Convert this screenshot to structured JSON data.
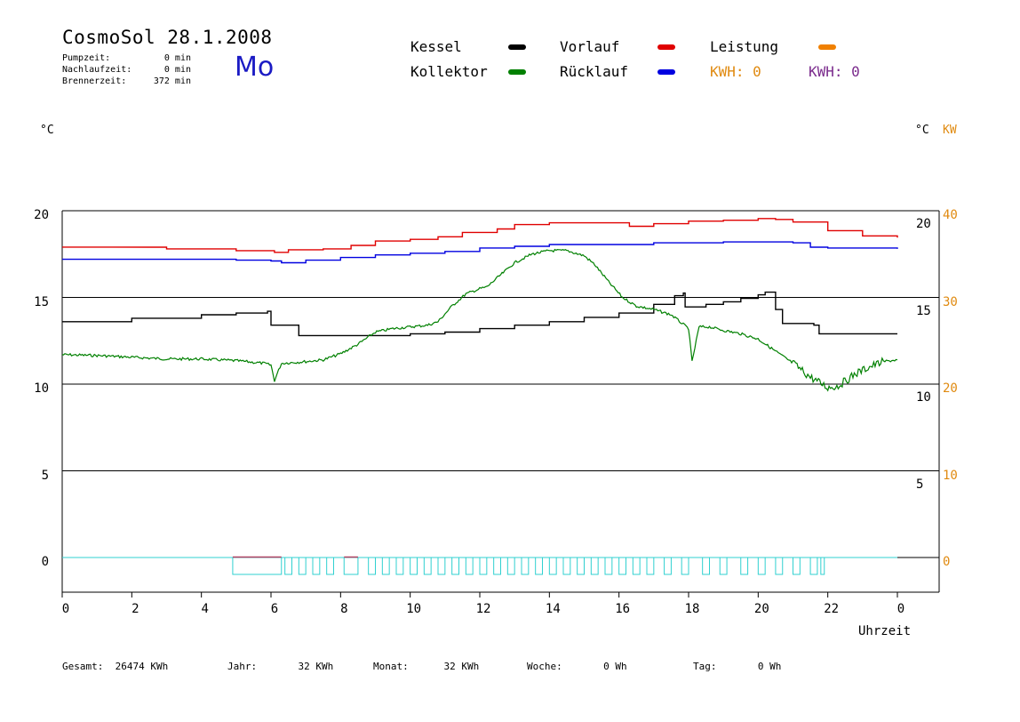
{
  "header": {
    "title": "CosmoSol 28.1.2008",
    "day": "Mo",
    "stats": [
      {
        "label": "Pumpzeit:",
        "value": "0 min"
      },
      {
        "label": "Nachlaufzeit:",
        "value": "0 min"
      },
      {
        "label": "Brennerzeit:",
        "value": "372 min"
      }
    ]
  },
  "legend": {
    "items": [
      {
        "name": "Kessel",
        "color": "#000000"
      },
      {
        "name": "Kollektor",
        "color": "#008000"
      },
      {
        "name": "Vorlauf",
        "color": "#e00000"
      },
      {
        "name": "Rücklauf",
        "color": "#0000e0"
      },
      {
        "name": "Leistung",
        "color": "#f08000"
      }
    ],
    "kwh_orange": {
      "label": "KWH:",
      "value": "0",
      "color": "#e08a10"
    },
    "kwh_purple": {
      "label": "KWH:",
      "value": "0",
      "color": "#7a2a8c"
    }
  },
  "axes": {
    "left_unit": "°C",
    "right_unit": "°C",
    "right_unit2": "KW",
    "xlabel": "Uhrzeit"
  },
  "footer": [
    {
      "label": "Gesamt:",
      "value": "26474 KWh"
    },
    {
      "label": "Jahr:",
      "value": "32 KWh"
    },
    {
      "label": "Monat:",
      "value": "32 KWh"
    },
    {
      "label": "Woche:",
      "value": "0 Wh"
    },
    {
      "label": "Tag:",
      "value": "0 Wh"
    }
  ],
  "chart_data": {
    "type": "line",
    "ylim": [
      -1.5,
      20.5
    ],
    "xlim": [
      0,
      24
    ],
    "x_ticks": [
      "0",
      "2",
      "4",
      "6",
      "8",
      "10",
      "12",
      "14",
      "16",
      "18",
      "20",
      "22",
      "0"
    ],
    "y_left_ticks": [
      "0",
      "5",
      "10",
      "15",
      "20"
    ],
    "y_right_ticks": [
      "5",
      "10",
      "15",
      "20"
    ],
    "y_right2_ticks": [
      "0",
      "10",
      "20",
      "30",
      "40"
    ],
    "grid_y": [
      5,
      10,
      15,
      20
    ],
    "series": [
      {
        "name": "Vorlauf",
        "color": "#e00000",
        "points": [
          [
            0,
            17.9
          ],
          [
            2.6,
            17.9
          ],
          [
            3,
            17.8
          ],
          [
            5,
            17.7
          ],
          [
            6.1,
            17.6
          ],
          [
            6.5,
            17.75
          ],
          [
            7.5,
            17.8
          ],
          [
            8.3,
            18.0
          ],
          [
            9,
            18.25
          ],
          [
            10,
            18.35
          ],
          [
            10.8,
            18.5
          ],
          [
            11.5,
            18.75
          ],
          [
            12.5,
            18.95
          ],
          [
            13,
            19.2
          ],
          [
            14,
            19.3
          ],
          [
            15.5,
            19.3
          ],
          [
            16.3,
            19.1
          ],
          [
            17,
            19.25
          ],
          [
            18,
            19.4
          ],
          [
            19,
            19.45
          ],
          [
            20,
            19.55
          ],
          [
            20.5,
            19.5
          ],
          [
            21,
            19.35
          ],
          [
            22,
            18.85
          ],
          [
            23,
            18.55
          ],
          [
            24,
            18.45
          ]
        ]
      },
      {
        "name": "Rücklauf",
        "color": "#0000e0",
        "points": [
          [
            0,
            17.2
          ],
          [
            3,
            17.2
          ],
          [
            5,
            17.15
          ],
          [
            6,
            17.1
          ],
          [
            6.3,
            17.0
          ],
          [
            7,
            17.15
          ],
          [
            8,
            17.3
          ],
          [
            9,
            17.45
          ],
          [
            10,
            17.55
          ],
          [
            11,
            17.65
          ],
          [
            12,
            17.85
          ],
          [
            13,
            17.95
          ],
          [
            14,
            18.05
          ],
          [
            15,
            18.05
          ],
          [
            16,
            18.05
          ],
          [
            17,
            18.15
          ],
          [
            18,
            18.15
          ],
          [
            19,
            18.2
          ],
          [
            20,
            18.2
          ],
          [
            21,
            18.15
          ],
          [
            21.5,
            17.9
          ],
          [
            22,
            17.85
          ],
          [
            24,
            17.8
          ]
        ]
      },
      {
        "name": "Kessel",
        "color": "#000000",
        "points": [
          [
            0,
            13.6
          ],
          [
            2,
            13.8
          ],
          [
            4,
            14.0
          ],
          [
            5,
            14.1
          ],
          [
            5.9,
            14.2
          ],
          [
            6,
            13.4
          ],
          [
            6.6,
            13.4
          ],
          [
            6.8,
            12.8
          ],
          [
            8,
            12.8
          ],
          [
            9,
            12.8
          ],
          [
            10,
            12.9
          ],
          [
            11,
            13.0
          ],
          [
            12,
            13.2
          ],
          [
            13,
            13.4
          ],
          [
            14,
            13.6
          ],
          [
            15,
            13.85
          ],
          [
            16,
            14.1
          ],
          [
            17,
            14.6
          ],
          [
            17.6,
            15.1
          ],
          [
            17.85,
            15.25
          ],
          [
            17.9,
            14.45
          ],
          [
            18.5,
            14.6
          ],
          [
            19,
            14.75
          ],
          [
            19.5,
            14.95
          ],
          [
            20,
            15.15
          ],
          [
            20.2,
            15.3
          ],
          [
            20.5,
            14.3
          ],
          [
            20.7,
            13.5
          ],
          [
            21.6,
            13.4
          ],
          [
            21.75,
            12.9
          ],
          [
            22,
            12.9
          ],
          [
            23.5,
            12.9
          ],
          [
            24,
            12.9
          ]
        ]
      },
      {
        "name": "Kollektor",
        "color": "#008000",
        "points": [
          [
            0,
            11.7
          ],
          [
            1,
            11.65
          ],
          [
            2,
            11.55
          ],
          [
            3,
            11.45
          ],
          [
            4,
            11.45
          ],
          [
            5,
            11.35
          ],
          [
            5.8,
            11.2
          ],
          [
            6,
            11.1
          ],
          [
            6.1,
            10.2
          ],
          [
            6.3,
            11.2
          ],
          [
            7,
            11.3
          ],
          [
            7.5,
            11.4
          ],
          [
            8,
            11.75
          ],
          [
            8.5,
            12.3
          ],
          [
            9,
            13.0
          ],
          [
            9.5,
            13.2
          ],
          [
            10,
            13.3
          ],
          [
            10.5,
            13.4
          ],
          [
            10.8,
            13.6
          ],
          [
            11.2,
            14.5
          ],
          [
            11.6,
            15.2
          ],
          [
            12,
            15.5
          ],
          [
            12.2,
            15.6
          ],
          [
            12.6,
            16.3
          ],
          [
            13,
            17.0
          ],
          [
            13.5,
            17.5
          ],
          [
            14,
            17.7
          ],
          [
            14.5,
            17.7
          ],
          [
            15,
            17.4
          ],
          [
            15.3,
            16.9
          ],
          [
            15.7,
            15.9
          ],
          [
            16.1,
            15.0
          ],
          [
            16.5,
            14.5
          ],
          [
            17,
            14.3
          ],
          [
            17.5,
            14.0
          ],
          [
            18,
            13.2
          ],
          [
            18.1,
            11.3
          ],
          [
            18.3,
            13.3
          ],
          [
            18.6,
            13.3
          ],
          [
            19,
            13.1
          ],
          [
            19.5,
            12.9
          ],
          [
            20,
            12.6
          ],
          [
            20.5,
            11.9
          ],
          [
            21,
            11.2
          ],
          [
            21.5,
            10.4
          ],
          [
            22,
            9.8
          ],
          [
            22.3,
            9.9
          ],
          [
            22.8,
            10.6
          ],
          [
            23.2,
            11.0
          ],
          [
            23.6,
            11.3
          ],
          [
            24,
            11.4
          ]
        ]
      }
    ],
    "pump_pulses": [
      [
        4.9,
        6.3
      ],
      [
        6.4,
        6.6
      ],
      [
        6.8,
        7.0
      ],
      [
        7.2,
        7.4
      ],
      [
        7.6,
        7.8
      ],
      [
        8.1,
        8.5
      ],
      [
        8.8,
        9.0
      ],
      [
        9.2,
        9.4
      ],
      [
        9.6,
        9.8
      ],
      [
        10.0,
        10.2
      ],
      [
        10.4,
        10.6
      ],
      [
        10.8,
        11.0
      ],
      [
        11.2,
        11.4
      ],
      [
        11.6,
        11.8
      ],
      [
        12.0,
        12.2
      ],
      [
        12.4,
        12.6
      ],
      [
        12.8,
        13.0
      ],
      [
        13.2,
        13.4
      ],
      [
        13.6,
        13.8
      ],
      [
        14.0,
        14.2
      ],
      [
        14.4,
        14.6
      ],
      [
        14.8,
        15.0
      ],
      [
        15.2,
        15.4
      ],
      [
        15.6,
        15.8
      ],
      [
        16.0,
        16.2
      ],
      [
        16.4,
        16.6
      ],
      [
        16.8,
        17.0
      ],
      [
        17.3,
        17.5
      ],
      [
        17.8,
        18.0
      ],
      [
        18.4,
        18.6
      ],
      [
        18.9,
        19.1
      ],
      [
        19.5,
        19.7
      ],
      [
        20.0,
        20.2
      ],
      [
        20.5,
        20.7
      ],
      [
        21.0,
        21.2
      ],
      [
        21.5,
        21.7
      ],
      [
        21.8,
        21.9
      ]
    ],
    "burner_pulses": [
      [
        4.9,
        6.3
      ],
      [
        8.1,
        8.5
      ]
    ]
  }
}
